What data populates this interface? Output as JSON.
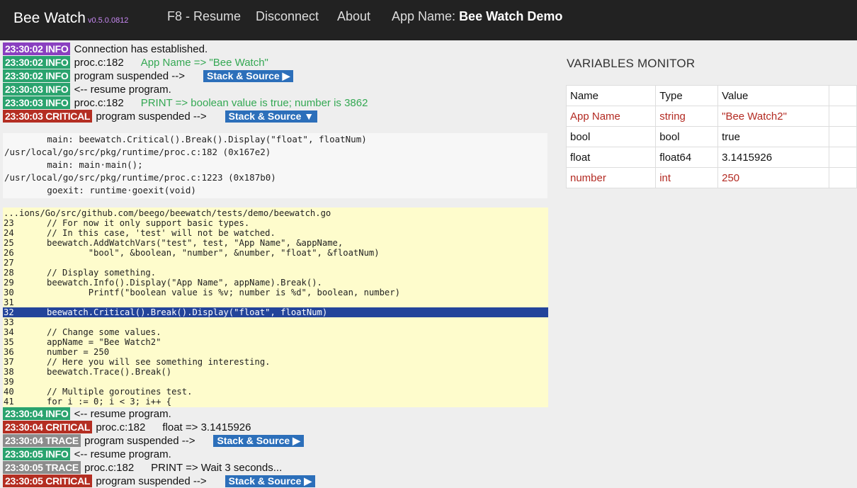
{
  "navbar": {
    "brand": "Bee Watch",
    "version": "v0.5.0.0812",
    "resume": "F8 - Resume",
    "disconnect": "Disconnect",
    "about": "About",
    "app_name_label": "App Name:",
    "app_name_value": "Bee Watch Demo"
  },
  "log_top": [
    {
      "time": "23:30:02",
      "level": "INFO",
      "text": "Connection has established.",
      "detail": "",
      "button": ""
    },
    {
      "time": "23:30:02",
      "level": "INFO",
      "text": "proc.c:182",
      "detail": "App Name => \"Bee Watch\"",
      "button": ""
    },
    {
      "time": "23:30:02",
      "level": "INFO",
      "text": "program suspended -->",
      "detail": "",
      "button": "Stack & Source ▶"
    },
    {
      "time": "23:30:03",
      "level": "INFO",
      "text": "<-- resume program.",
      "detail": "",
      "button": ""
    },
    {
      "time": "23:30:03",
      "level": "INFO",
      "text": "proc.c:182",
      "detail": "PRINT => boolean value is true; number is 3862",
      "button": ""
    },
    {
      "time": "23:30:03",
      "level": "CRITICAL",
      "text": "program suspended -->",
      "detail": "",
      "button": "Stack & Source ▼"
    }
  ],
  "stack": [
    "        main: beewatch.Critical().Break().Display(\"float\", floatNum)",
    "/usr/local/go/src/pkg/runtime/proc.c:182 (0x167e2)",
    "        main: main·main();",
    "/usr/local/go/src/pkg/runtime/proc.c:1223 (0x187b0)",
    "        goexit: runtime·goexit(void)"
  ],
  "source": {
    "path": "...ions/Go/src/github.com/beego/beewatch/tests/demo/beewatch.go",
    "highlight_line": "32",
    "lines": [
      {
        "n": "23",
        "code": "// For now it only support basic types."
      },
      {
        "n": "24",
        "code": "// In this case, 'test' will not be watched."
      },
      {
        "n": "25",
        "code": "beewatch.AddWatchVars(\"test\", test, \"App Name\", &appName,"
      },
      {
        "n": "26",
        "code": "        \"bool\", &boolean, \"number\", &number, \"float\", &floatNum)"
      },
      {
        "n": "27",
        "code": ""
      },
      {
        "n": "28",
        "code": "// Display something."
      },
      {
        "n": "29",
        "code": "beewatch.Info().Display(\"App Name\", appName).Break()."
      },
      {
        "n": "30",
        "code": "        Printf(\"boolean value is %v; number is %d\", boolean, number)"
      },
      {
        "n": "31",
        "code": ""
      },
      {
        "n": "32",
        "code": "beewatch.Critical().Break().Display(\"float\", floatNum)"
      },
      {
        "n": "33",
        "code": ""
      },
      {
        "n": "34",
        "code": "// Change some values."
      },
      {
        "n": "35",
        "code": "appName = \"Bee Watch2\""
      },
      {
        "n": "36",
        "code": "number = 250"
      },
      {
        "n": "37",
        "code": "// Here you will see something interesting."
      },
      {
        "n": "38",
        "code": "beewatch.Trace().Break()"
      },
      {
        "n": "39",
        "code": ""
      },
      {
        "n": "40",
        "code": "// Multiple goroutines test."
      },
      {
        "n": "41",
        "code": "for i := 0; i < 3; i++ {"
      }
    ]
  },
  "log_bottom": [
    {
      "time": "23:30:04",
      "level": "INFO",
      "text": "<-- resume program.",
      "detail": "",
      "button": ""
    },
    {
      "time": "23:30:04",
      "level": "CRITICAL",
      "text": "proc.c:182",
      "detail": "float => 3.1415926",
      "button": ""
    },
    {
      "time": "23:30:04",
      "level": "TRACE",
      "text": "program suspended -->",
      "detail": "",
      "button": "Stack & Source ▶"
    },
    {
      "time": "23:30:05",
      "level": "INFO",
      "text": "<-- resume program.",
      "detail": "",
      "button": ""
    },
    {
      "time": "23:30:05",
      "level": "TRACE",
      "text": "proc.c:182",
      "detail": "PRINT => Wait 3 seconds...",
      "button": ""
    },
    {
      "time": "23:30:05",
      "level": "CRITICAL",
      "text": "program suspended -->",
      "detail": "",
      "button": "Stack & Source ▶"
    }
  ],
  "variables": {
    "title": "VARIABLES MONITOR",
    "headers": [
      "Name",
      "Type",
      "Value",
      ""
    ],
    "rows": [
      {
        "name": "App Name",
        "type": "string",
        "value": "\"Bee Watch2\"",
        "changed": true
      },
      {
        "name": "bool",
        "type": "bool",
        "value": "true",
        "changed": false
      },
      {
        "name": "float",
        "type": "float64",
        "value": "3.1415926",
        "changed": false
      },
      {
        "name": "number",
        "type": "int",
        "value": "250",
        "changed": true
      }
    ]
  },
  "colors": {
    "navbar": "#222222",
    "info": "#2aa36e",
    "critical": "#b42e22",
    "trace": "#8c8c8c",
    "button": "#2c6fba",
    "source_bg": "#fefccc",
    "highlight": "#23449a",
    "changed": "#b32a22"
  }
}
